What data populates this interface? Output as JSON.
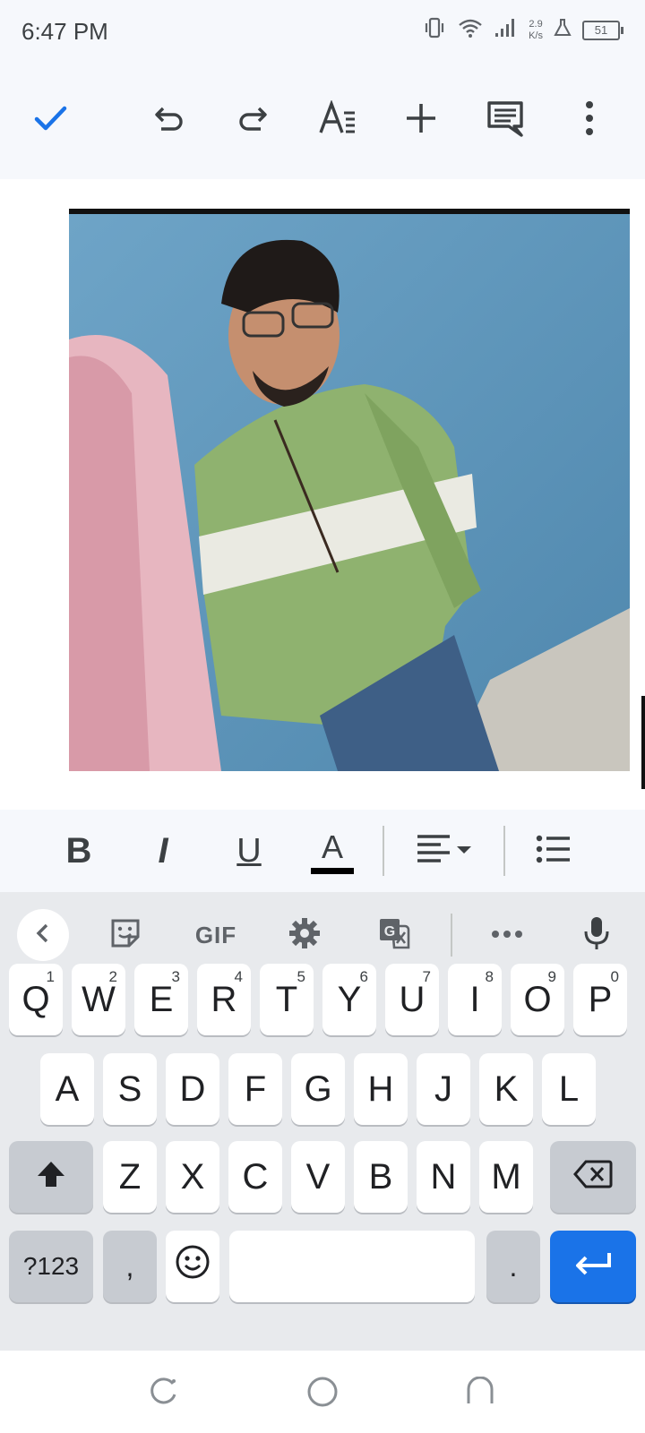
{
  "status": {
    "time": "6:47 PM",
    "speed_value": "2.9",
    "speed_unit": "K/s",
    "battery": "51"
  },
  "toolbar": {
    "done": "check-icon",
    "undo": "undo-icon",
    "redo": "redo-icon",
    "text_format": "text-format-icon",
    "insert": "add-icon",
    "comment": "comment-icon",
    "more": "more-vert-icon",
    "accent": "#1a73e8"
  },
  "document": {
    "image": "inserted-photo"
  },
  "format_bar": {
    "bold": "B",
    "italic": "I",
    "underline": "U",
    "text_color": "A",
    "align": "align-left-icon",
    "list": "bulleted-list-icon"
  },
  "keyboard": {
    "toolbar": {
      "gif": "GIF"
    },
    "row1": [
      {
        "k": "Q",
        "s": "1"
      },
      {
        "k": "W",
        "s": "2"
      },
      {
        "k": "E",
        "s": "3"
      },
      {
        "k": "R",
        "s": "4"
      },
      {
        "k": "T",
        "s": "5"
      },
      {
        "k": "Y",
        "s": "6"
      },
      {
        "k": "U",
        "s": "7"
      },
      {
        "k": "I",
        "s": "8"
      },
      {
        "k": "O",
        "s": "9"
      },
      {
        "k": "P",
        "s": "0"
      }
    ],
    "row2": [
      "A",
      "S",
      "D",
      "F",
      "G",
      "H",
      "J",
      "K",
      "L"
    ],
    "row3": [
      "Z",
      "X",
      "C",
      "V",
      "B",
      "N",
      "M"
    ],
    "symbols": "?123",
    "comma": ",",
    "period": "."
  }
}
